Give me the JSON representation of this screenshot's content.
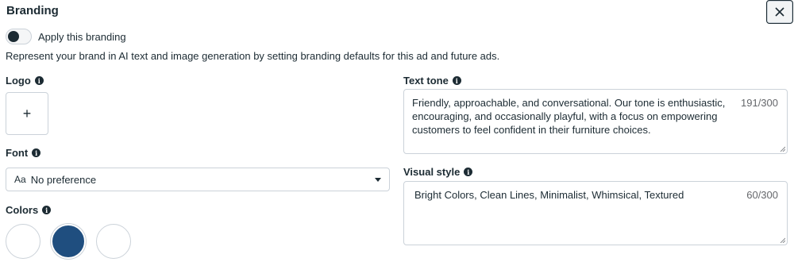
{
  "title": "Branding",
  "toggle": {
    "label": "Apply this branding",
    "on": false
  },
  "description": "Represent your brand in AI text and image generation by setting branding defaults for this ad and future ads.",
  "logo": {
    "label": "Logo",
    "add_symbol": "+"
  },
  "font": {
    "label": "Font",
    "prefix": "Aa",
    "value": "No preference"
  },
  "colors": {
    "label": "Colors",
    "swatches": [
      "#ffffff",
      "#1f4e7f",
      "#ffffff"
    ],
    "selected_index": 1
  },
  "text_tone": {
    "label": "Text tone",
    "value": "Friendly, approachable, and conversational. Our tone is enthusiastic, encouraging, and occasionally playful, with a focus on empowering customers to feel confident in their furniture choices.",
    "counter": "191/300"
  },
  "visual_style": {
    "label": "Visual style",
    "value": "Bright Colors, Clean Lines, Minimalist, Whimsical, Textured",
    "counter": "60/300"
  },
  "icons": {
    "close": "close-icon",
    "info": "info-icon",
    "dropdown": "chevron-down-icon"
  }
}
